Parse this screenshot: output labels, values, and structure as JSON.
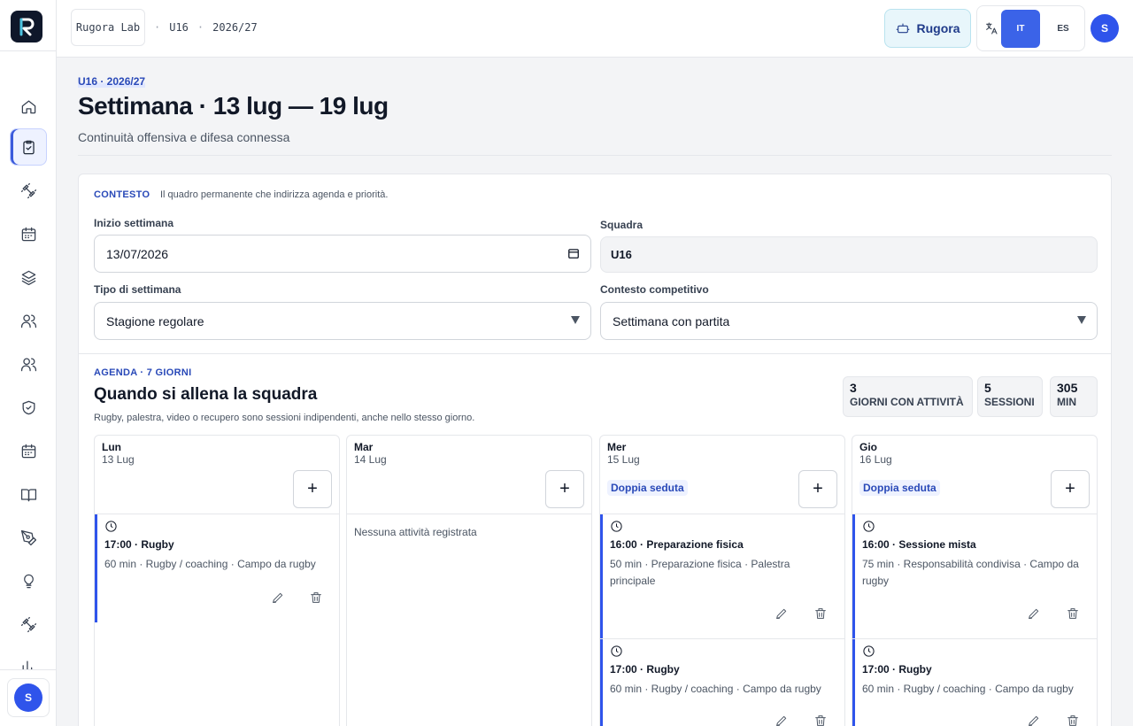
{
  "colors": {
    "accent": "#2f54eb",
    "brand_dark": "#0f172a",
    "label_blue": "#2949b8"
  },
  "sidebar": {
    "items": [
      {
        "icon": "home-icon"
      },
      {
        "icon": "clipboard-check-icon",
        "active": true
      },
      {
        "icon": "dumbbell-icon"
      },
      {
        "icon": "calendar-icon"
      },
      {
        "icon": "layers-icon"
      },
      {
        "icon": "users-icon"
      },
      {
        "icon": "users-alt-icon"
      },
      {
        "icon": "shield-check-icon"
      },
      {
        "icon": "calendar-alt-icon"
      },
      {
        "icon": "book-open-icon"
      },
      {
        "icon": "pen-tool-icon"
      },
      {
        "icon": "lightbulb-icon"
      },
      {
        "icon": "dumbbell-alt-icon"
      },
      {
        "icon": "bar-chart-icon"
      }
    ],
    "avatar_initial": "S"
  },
  "topbar": {
    "org": "Rugora Lab",
    "team": "U16",
    "season": "2026/27",
    "sep": "·",
    "assistant_label": "Rugora",
    "lang_it": "IT",
    "lang_es": "ES",
    "avatar_initial": "S"
  },
  "header": {
    "eyebrow": "U16 · 2026/27",
    "title": "Settimana · 13 lug — 19 lug",
    "subtitle": "Continuità offensiva e difesa connessa"
  },
  "context": {
    "label": "CONTESTO",
    "description": "Il quadro permanente che indirizza agenda e priorità.",
    "week_start_label": "Inizio settimana",
    "week_start_value": "13/07/2026",
    "team_label": "Squadra",
    "team_value": "U16",
    "week_type_label": "Tipo di settimana",
    "week_type_value": "Stagione regolare",
    "competitive_label": "Contesto competitivo",
    "competitive_value": "Settimana con partita"
  },
  "agenda": {
    "label": "AGENDA · 7 GIORNI",
    "title": "Quando si allena la squadra",
    "description": "Rugby, palestra, video o recupero sono sessioni indipendenti, anche nello stesso giorno.",
    "stats": [
      {
        "value": "3",
        "label": "GIORNI CON ATTIVITÀ"
      },
      {
        "value": "5",
        "label": "SESSIONI"
      },
      {
        "value": "305",
        "label": "MIN"
      }
    ],
    "days": [
      {
        "name": "Lun",
        "date": "13 Lug",
        "badge": "",
        "empty_text": "",
        "sessions": [
          {
            "title": "17:00 · Rugby",
            "meta": "60 min · Rugby / coaching · Campo da rugby"
          }
        ]
      },
      {
        "name": "Mar",
        "date": "14 Lug",
        "badge": "",
        "empty_text": "Nessuna attività registrata",
        "sessions": []
      },
      {
        "name": "Mer",
        "date": "15 Lug",
        "badge": "Doppia seduta",
        "empty_text": "",
        "sessions": [
          {
            "title": "16:00 · Preparazione fisica",
            "meta": "50 min · Preparazione fisica · Palestra principale"
          },
          {
            "title": "17:00 · Rugby",
            "meta": "60 min · Rugby / coaching · Campo da rugby"
          }
        ]
      },
      {
        "name": "Gio",
        "date": "16 Lug",
        "badge": "Doppia seduta",
        "empty_text": "",
        "sessions": [
          {
            "title": "16:00 · Sessione mista",
            "meta": "75 min · Responsabilità condivisa · Campo da rugby"
          },
          {
            "title": "17:00 · Rugby",
            "meta": "60 min · Rugby / coaching · Campo da rugby"
          }
        ]
      }
    ]
  }
}
